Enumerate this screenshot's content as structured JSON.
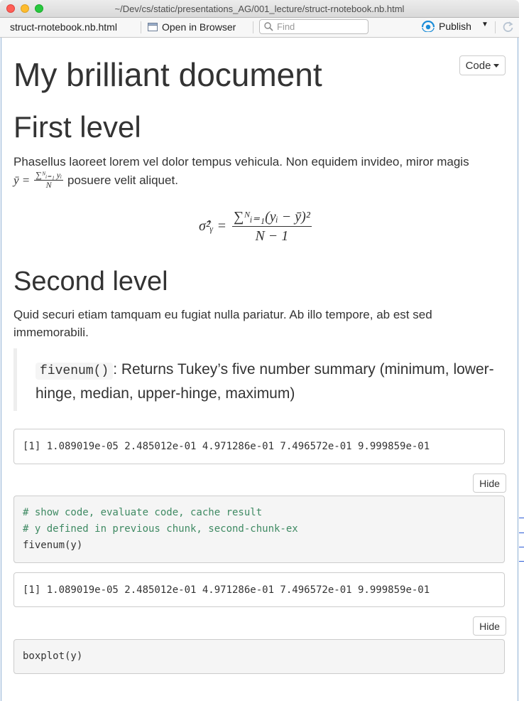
{
  "window": {
    "title": "~/Dev/cs/static/presentations_AG/001_lecture/struct-rnotebook.nb.html"
  },
  "toolbar": {
    "file_name": "struct-rnotebook.nb.html",
    "open_in_browser": "Open in Browser",
    "find_placeholder": "Find",
    "publish_label": "Publish"
  },
  "document": {
    "code_dropdown": "Code",
    "title": "My brilliant document",
    "heading1": "First level",
    "para1": "Phasellus laoreet lorem vel dolor tempus vehicula. Non equidem invideo, miror magis",
    "inline_math": {
      "lhs": "ȳ =",
      "num": "∑ᴺᵢ₌₁ yᵢ",
      "den": "N",
      "after": "posuere velit aliquet."
    },
    "display_math": {
      "lhs": "σ̂²ᵧ =",
      "num": "∑ᴺᵢ₌₁(yᵢ − ȳ)²",
      "den": "N − 1"
    },
    "heading2": "Second level",
    "para2": "Quid securi etiam tamquam eu fugiat nulla pariatur. Ab illo tempore, ab est sed immemorabili.",
    "quote": {
      "code": "fivenum()",
      "text": ": Returns Tukey’s five number summary (minimum, lower-hinge, median, upper-hinge, maximum)"
    },
    "output1": "[1] 1.089019e-05 2.485012e-01 4.971286e-01 7.496572e-01 9.999859e-01",
    "hide1": "Hide",
    "chunk1": {
      "comment1": "# show code, evaluate code, cache result",
      "comment2": "# y defined in previous chunk, second-chunk-ex",
      "line": "fivenum(y)"
    },
    "output2": "[1] 1.089019e-05 2.485012e-01 4.971286e-01 7.496572e-01 9.999859e-01",
    "hide2": "Hide",
    "chunk2": {
      "line": "boxplot(y)"
    }
  },
  "colors": {
    "comment": "#3f8a63",
    "publish_icon": "#1a8cd8"
  }
}
